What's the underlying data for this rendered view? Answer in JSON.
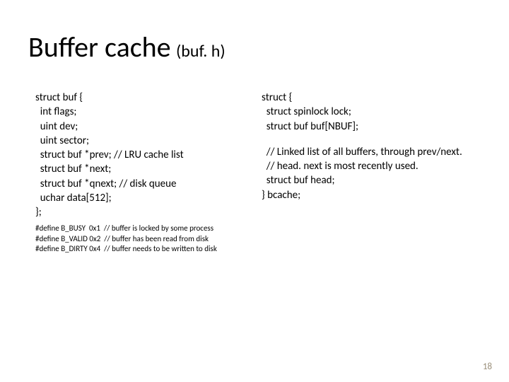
{
  "title": {
    "main": "Buffer cache",
    "sub": " (buf. h)"
  },
  "left": {
    "code": "struct buf {\n  int flags;\n  uint dev;\n  uint sector;\n  struct buf *prev; // LRU cache list\n  struct buf *next;\n  struct buf *qnext; // disk queue\n  uchar data[512];\n};",
    "defs": "#define B_BUSY  0x1  // buffer is locked by some process\n#define B_VALID 0x2  // buffer has been read from disk\n#define B_DIRTY 0x4  // buffer needs to be written to disk"
  },
  "right": {
    "code1": "struct {\n  struct spinlock lock;\n  struct buf buf[NBUF];",
    "code2": "  // Linked list of all buffers, through prev/next.\n  // head. next is most recently used.\n  struct buf head;\n} bcache;"
  },
  "page": "18"
}
